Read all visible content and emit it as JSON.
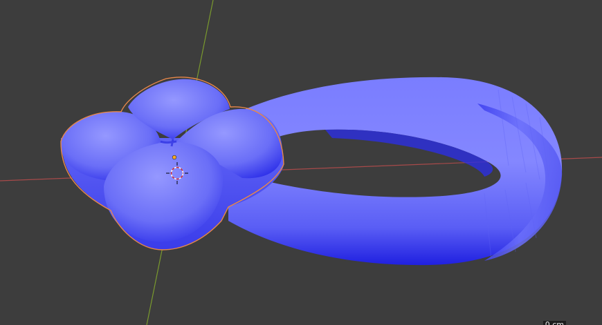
{
  "viewport": {
    "background": "#3d3d3d",
    "x_axis_color": "#a84a4a",
    "y_axis_color": "#7a9a2e",
    "mesh_color": "#6a6ef0",
    "mesh_highlight": "#8a8dff",
    "mesh_shadow": "#1a1adc",
    "selection_outline_color": "#e8884a",
    "origin_color": "#ffaa22",
    "cursor_icon": "3d-cursor-icon",
    "scale_label": "0 cm"
  }
}
